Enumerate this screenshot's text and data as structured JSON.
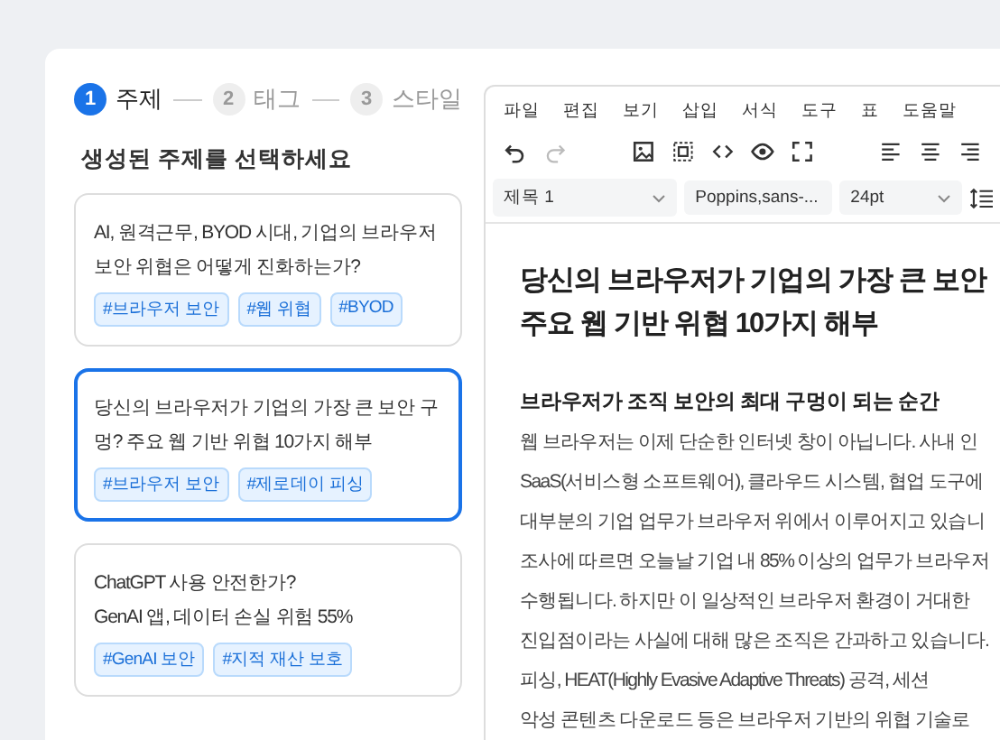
{
  "steps": [
    {
      "number": "1",
      "label": "주제",
      "selected": true
    },
    {
      "number": "2",
      "label": "태그",
      "selected": false
    },
    {
      "number": "3",
      "label": "스타일",
      "selected": false
    }
  ],
  "prompt": "생성된 주제를 선택하세요",
  "topics": [
    {
      "title": "AI, 원격근무, BYOD 시대, 기업의 브라우저 보안 위협은 어떻게 진화하는가?",
      "tags": [
        "#브라우저 보안",
        "#웹 위협",
        "#BYOD"
      ],
      "selected": false
    },
    {
      "title": "당신의 브라우저가 기업의 가장 큰 보안 구멍? 주요 웹 기반 위협 10가지 해부",
      "tags": [
        "#브라우저 보안",
        "#제로데이 피싱"
      ],
      "selected": true
    },
    {
      "title": "ChatGPT 사용 안전한가?\nGenAI 앱, 데이터 손실 위험 55%",
      "tags": [
        "#GenAI 보안",
        "#지적 재산 보호"
      ],
      "selected": false
    }
  ],
  "editor": {
    "menu": [
      "파일",
      "편집",
      "보기",
      "삽입",
      "서식",
      "도구",
      "표",
      "도움말"
    ],
    "format": {
      "block": "제목 1",
      "font": "Poppins,sans-...",
      "size": "24pt"
    },
    "title_lines": [
      "당신의 브라우저가 기업의 가장 큰 보안",
      "주요 웹 기반 위협 10가지 해부"
    ],
    "heading": "브라우저가 조직 보안의 최대 구멍이 되는 순간",
    "body_lines": [
      "웹 브라우저는 이제 단순한 인터넷 창이 아닙니다. 사내 인",
      "SaaS(서비스형 소프트웨어), 클라우드 시스템, 협업 도구에",
      "대부분의 기업 업무가 브라우저 위에서 이루어지고 있습니",
      "조사에 따르면 오늘날 기업 내 85% 이상의 업무가 브라우저",
      "수행됩니다. 하지만 이 일상적인 브라우저 환경이 거대한",
      "진입점이라는 사실에 대해 많은 조직은 간과하고 있습니다.",
      "피싱, HEAT(Highly Evasive Adaptive Threats) 공격, 세션",
      "악성 콘텐츠 다운로드 등은 브라우저 기반의 위협 기술로"
    ]
  }
}
